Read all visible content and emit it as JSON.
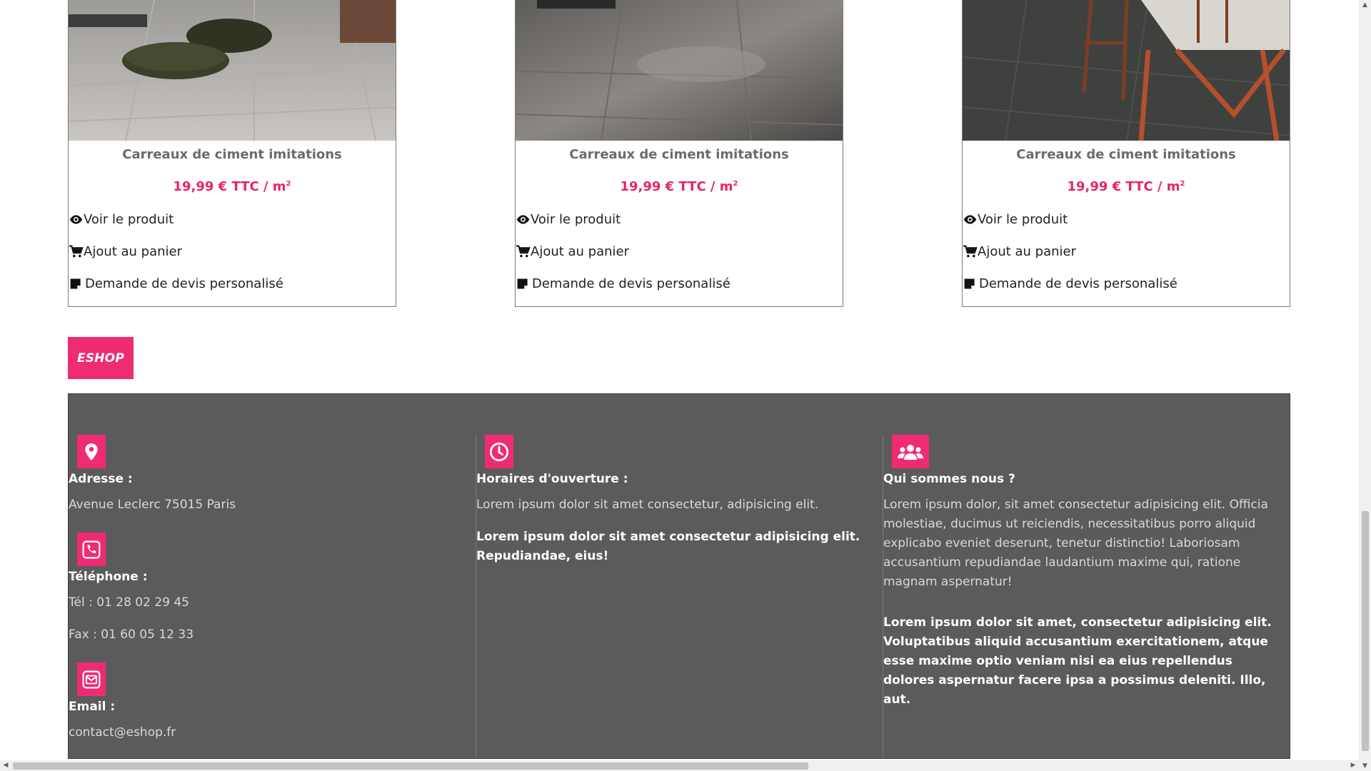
{
  "products": [
    {
      "title": "Carreaux de ciment imitations",
      "price": "19,99 € TTC / m",
      "price_sup": "2",
      "view_label": "Voir le produit",
      "cart_label": "Ajout au panier",
      "quote_label": "Demande de devis personalisé"
    },
    {
      "title": "Carreaux de ciment imitations",
      "price": "19,99 € TTC / m",
      "price_sup": "2",
      "view_label": "Voir le produit",
      "cart_label": "Ajout au panier",
      "quote_label": "Demande de devis personalisé"
    },
    {
      "title": "Carreaux de ciment imitations",
      "price": "19,99 € TTC / m",
      "price_sup": "2",
      "view_label": "Voir le produit",
      "cart_label": "Ajout au panier",
      "quote_label": "Demande de devis personalisé"
    }
  ],
  "eshop_button": "ESHOP",
  "footer": {
    "address": {
      "icon": "map-pin-icon",
      "heading": "Adresse :",
      "text": "Avenue Leclerc 75015 Paris"
    },
    "phone": {
      "icon": "phone-icon",
      "heading": "Téléphone :",
      "tel": "Tél : 01 28 02 29 45",
      "fax": "Fax : 01 60 05 12 33"
    },
    "email": {
      "icon": "envelope-icon",
      "heading": "Email :",
      "text": "contact@eshop.fr"
    },
    "hours": {
      "icon": "clock-icon",
      "heading": "Horaires d'ouverture :",
      "text": "Lorem ipsum dolor sit amet consectetur, adipisicing elit.",
      "bold": "Lorem ipsum dolor sit amet consectetur adipisicing elit. Repudiandae, eius!"
    },
    "about": {
      "icon": "users-icon",
      "heading": "Qui sommes nous ?",
      "text": "Lorem ipsum dolor, sit amet consectetur adipisicing elit. Officia molestiae, ducimus ut reiciendis, necessitatibus porro aliquid explicabo eveniet deserunt, tenetur distinctio! Laboriosam accusantium repudiandae laudantium maxime qui, ratione magnam aspernatur!",
      "bold": "Lorem ipsum dolor sit amet, consectetur adipisicing elit. Voluptatibus aliquid accusantium exercitationem, atque esse maxime optio veniam nisi ea eius repellendus dolores aspernatur facere ipsa a possimus deleniti. Illo, aut."
    }
  },
  "colors": {
    "accent": "#ef2b74",
    "price": "#e8236b",
    "footer_bg": "#5b5b5b"
  }
}
